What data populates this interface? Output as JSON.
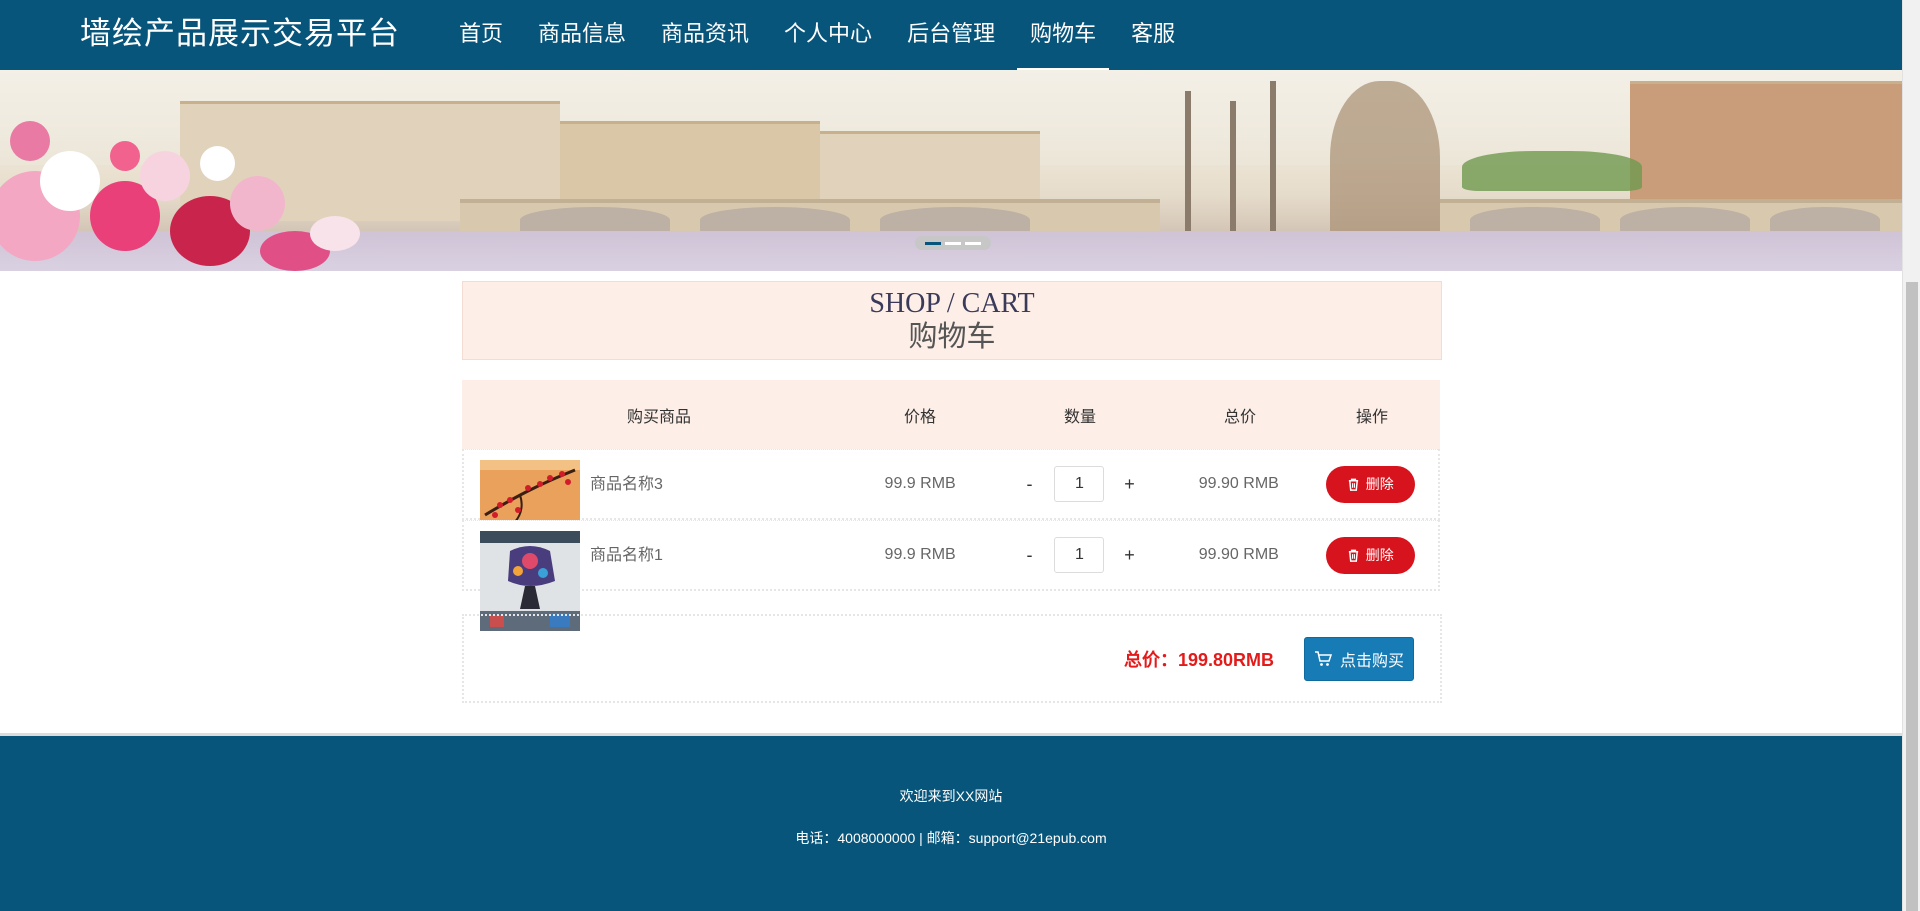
{
  "header": {
    "logo": "墙绘产品展示交易平台",
    "nav": [
      "首页",
      "商品信息",
      "商品资讯",
      "个人中心",
      "后台管理",
      "购物车",
      "客服"
    ],
    "active_index": 5
  },
  "banner": {
    "slides_total": 3,
    "active_slide": 1
  },
  "shop_title": {
    "en": "SHOP / CART",
    "cn": "购物车"
  },
  "table": {
    "headers": [
      "购买商品",
      "价格",
      "数量",
      "总价",
      "操作"
    ],
    "rows": [
      {
        "name": "商品名称3",
        "price": "99.9 RMB",
        "qty": "1",
        "total": "99.90 RMB",
        "delete_label": "删除",
        "minus": "-",
        "plus": "+"
      },
      {
        "name": "商品名称1",
        "price": "99.9 RMB",
        "qty": "1",
        "total": "99.90 RMB",
        "delete_label": "删除",
        "minus": "-",
        "plus": "+"
      }
    ]
  },
  "summary": {
    "total_label": "总价：199.80RMB",
    "buy_label": "点击购买"
  },
  "footer": {
    "welcome": "欢迎来到XX网站",
    "contact": "电话：4008000000 | 邮箱：support@21epub.com"
  },
  "colors": {
    "brand": "#07557b",
    "accent_red": "#d7131d",
    "buy_blue": "#177bb5",
    "title_bg": "#fdeee7"
  }
}
